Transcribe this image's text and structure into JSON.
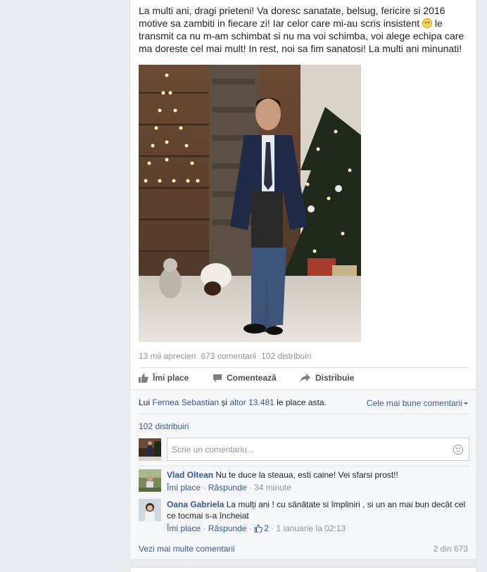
{
  "post": {
    "text_before_emoji": "La multi ani, dragi prieteni! Va doresc sanatate, belsug, fericire si 2016 motive sa zambiti in fiecare zi! Iar celor care mi-au scris insistent ",
    "emoji": "smiley-emoji",
    "text_after_emoji": " le transmit ca nu m-am schimbat si nu ma voi schimba, voi alege echipa care ma doreste cel mai mult! In rest, noi sa fim sanatosi! La multi ani minunati!",
    "photo": "photo-man-in-suit-christmas-tree"
  },
  "stats": {
    "likes": "13 mii aprecieri",
    "comments": "673 comentarii",
    "shares": "102 distribuiri"
  },
  "actions": {
    "like": "Îmi place",
    "comment": "Comentează",
    "share": "Distribuie"
  },
  "likes_summary": {
    "prefix": "Lui ",
    "person": "Fernea Sebastian",
    "and": " și ",
    "others": "altor 13.481",
    "suffix": " le place asta."
  },
  "sort_label": "Cele mai bune comentarii",
  "shares_link": "102 distribuiri",
  "comment_input": {
    "placeholder": "Scrie un comentariu..."
  },
  "comments": [
    {
      "author": "Vlad Oltean",
      "text": "Nu te duce la steaua, esti caine! Vei sfarsi prost!!",
      "like": "Îmi place",
      "reply": "Răspunde",
      "time": "34 minute"
    },
    {
      "author": "Oana Gabriela",
      "text": "La mulți ani ! cu sănătate si împliniri , si un an mai bun decât cel ce tocmai s-a încheiat",
      "like": "Îmi place",
      "reply": "Răspunde",
      "reactions": "2",
      "time": "1 ianuarie la 02:13"
    }
  ],
  "more_comments": "Vezi mai multe comentarii",
  "comments_count": "2 din 673",
  "colors": {
    "link": "#365899",
    "muted": "#90949c",
    "background": "#e9ebee"
  }
}
